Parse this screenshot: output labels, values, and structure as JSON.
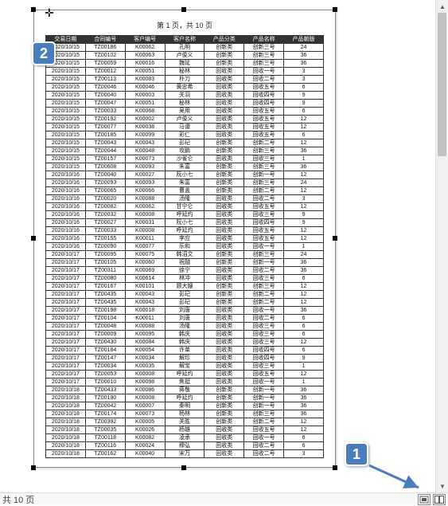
{
  "page_header": "第 1 页，共 10 页",
  "status_text": "共 10 页",
  "callouts": {
    "c1": "1",
    "c2": "2"
  },
  "headers": [
    "交易日期",
    "合同编号",
    "客户编号",
    "客户名称",
    "产品分类",
    "产品名称",
    "产品朝版"
  ],
  "chart_data": {
    "type": "table",
    "columns": [
      "交易日期",
      "合同编号",
      "客户编号",
      "客户名称",
      "产品分类",
      "产品名称",
      "产品朝版"
    ],
    "rows": [
      [
        "2020/10/15",
        "TZ00186",
        "K00062",
        "孔明",
        "创新类",
        "创新三号",
        "24"
      ],
      [
        "2020/10/15",
        "TZ00102",
        "K00063",
        "卢俊义",
        "创新类",
        "创新三号",
        "36"
      ],
      [
        "2020/10/15",
        "TZ00059",
        "K00016",
        "魏延",
        "创新类",
        "创新三号",
        "36"
      ],
      [
        "2020/10/15",
        "TZ00012",
        "K00051",
        "秘林",
        "回收类",
        "回收一号",
        "3"
      ],
      [
        "2020/10/15",
        "TZ00113",
        "K00083",
        "朴刀",
        "回收类",
        "回收二号",
        "3"
      ],
      [
        "2020/10/15",
        "TZ00046",
        "K00046",
        "黄忠希",
        "回收类",
        "回收五号",
        "6"
      ],
      [
        "2020/10/15",
        "TZ00040",
        "K00003",
        "关羽",
        "回收类",
        "回收四号",
        "9"
      ],
      [
        "2020/10/15",
        "TZ00047",
        "K00051",
        "秘林",
        "回收类",
        "回收四号",
        "9"
      ],
      [
        "2020/10/15",
        "TZ00033",
        "K00068",
        "吴用",
        "回收类",
        "回收五号",
        "6"
      ],
      [
        "2020/10/15",
        "TZ00192",
        "K00002",
        "卢俊义",
        "回收类",
        "回收五号",
        "12"
      ],
      [
        "2020/10/15",
        "TZ00077",
        "K00038",
        "马谡",
        "回收类",
        "回收五号",
        "12"
      ],
      [
        "2020/10/15",
        "TZ00185",
        "K00099",
        "彩仁",
        "回收类",
        "回收五号",
        "6"
      ],
      [
        "2020/10/15",
        "TZ00043",
        "K00043",
        "彭玘",
        "创新类",
        "创新二号",
        "12"
      ],
      [
        "2020/10/15",
        "TZ00044",
        "K00048",
        "攻鹏",
        "创新类",
        "创新三号",
        "36"
      ],
      [
        "2020/10/15",
        "TZ00157",
        "K00073",
        "沙雀仑",
        "回收类",
        "回收三号",
        "1"
      ],
      [
        "2020/10/15",
        "TZ00608",
        "K00093",
        "朱富",
        "创新类",
        "创新三号",
        "36"
      ],
      [
        "2020/10/16",
        "TZ00040",
        "K00027",
        "阮小七",
        "创新类",
        "创新一号",
        "12"
      ],
      [
        "2020/10/16",
        "TZ00093",
        "K00093",
        "朱富",
        "创新类",
        "创新三号",
        "24"
      ],
      [
        "2020/10/16",
        "TZ00065",
        "K00066",
        "曹盖",
        "创新类",
        "创新二号",
        "12"
      ],
      [
        "2020/10/16",
        "TZ00020",
        "K00088",
        "汤隆",
        "回收类",
        "回收二号",
        "3"
      ],
      [
        "2020/10/16",
        "TZ00082",
        "K00062",
        "甘宁仑",
        "回收类",
        "回收五号",
        "12"
      ],
      [
        "2020/10/16",
        "TZ00032",
        "K00008",
        "呼延灼",
        "回收类",
        "回收三号",
        "9"
      ],
      [
        "2020/10/16",
        "TZ00027",
        "K00031",
        "阮小七",
        "回收类",
        "回收四号",
        "9"
      ],
      [
        "2020/10/16",
        "TZ00033",
        "K00008",
        "呼延灼",
        "回收类",
        "回收五号",
        "12"
      ],
      [
        "2020/10/16",
        "TZ00155",
        "K00011",
        "李应",
        "回收类",
        "回收五号",
        "12"
      ],
      [
        "2020/10/16",
        "TZ00090",
        "K00077",
        "乐和",
        "回收类",
        "回收一号",
        "1"
      ],
      [
        "2020/10/17",
        "TZ00095",
        "K00075",
        "韩滔文",
        "创新类",
        "创新三号",
        "24"
      ],
      [
        "2020/10/17",
        "TZ00105",
        "K00060",
        "祝融",
        "创新类",
        "创新一号",
        "36"
      ],
      [
        "2020/10/17",
        "TZ00311",
        "K00069",
        "徐宁",
        "回收类",
        "回收二号",
        "36"
      ],
      [
        "2020/10/17",
        "TZ00080",
        "K00614",
        "林冲",
        "回收类",
        "回收三号",
        "6"
      ],
      [
        "2020/10/17",
        "TZ00167",
        "K00101",
        "顾大嫂",
        "创新类",
        "创新三号",
        "12"
      ],
      [
        "2020/10/17",
        "TZ00435",
        "K00043",
        "彭玘",
        "创新类",
        "创新二号",
        "12"
      ],
      [
        "2020/10/17",
        "TZ00435",
        "K00043",
        "彭玘",
        "创新类",
        "创新二号",
        "12"
      ],
      [
        "2020/10/17",
        "TZ00198",
        "K00018",
        "刘唐",
        "回收类",
        "回收一号",
        "36"
      ],
      [
        "2020/10/17",
        "TZ00104",
        "K00011",
        "刘唐",
        "回收类",
        "回收二号",
        "6"
      ],
      [
        "2020/10/17",
        "TZ00048",
        "K00088",
        "汤隆",
        "回收类",
        "回收三号",
        "6"
      ],
      [
        "2020/10/17",
        "TZ00009",
        "K00095",
        "韩庆",
        "回收类",
        "回收三号",
        "6"
      ],
      [
        "2020/10/17",
        "TZ00430",
        "K00084",
        "韩庆",
        "回收类",
        "回收三号",
        "12"
      ],
      [
        "2020/10/17",
        "TZ00184",
        "K00054",
        "许单",
        "回收类",
        "回收四号",
        "6"
      ],
      [
        "2020/10/17",
        "TZ00147",
        "K00034",
        "解珍",
        "回收类",
        "回收四号",
        "9"
      ],
      [
        "2020/10/17",
        "TZ00034",
        "K00035",
        "解宝",
        "回收类",
        "回收三号",
        "1"
      ],
      [
        "2020/10/17",
        "TZ00053",
        "K00008",
        "呼延灼",
        "回收类",
        "回收五号",
        "12"
      ],
      [
        "2020/10/17",
        "TZ00010",
        "K00098",
        "焦挺",
        "回收类",
        "回收一号",
        "1"
      ],
      [
        "2020/10/18",
        "TZ00433",
        "K00086",
        "蒋敬",
        "创新类",
        "创新一号",
        "36"
      ],
      [
        "2020/10/18",
        "TZ00190",
        "K00008",
        "呼延灼",
        "创新类",
        "创新一号",
        "36"
      ],
      [
        "2020/10/18",
        "TZ00042",
        "K00007",
        "秦明",
        "创新类",
        "创新一号",
        "36"
      ],
      [
        "2020/10/18",
        "TZ00174",
        "K00073",
        "杨林",
        "创新类",
        "创新三号",
        "36"
      ],
      [
        "2020/10/18",
        "TZ00392",
        "K00005",
        "关胜",
        "创新类",
        "创新二号",
        "12"
      ],
      [
        "2020/10/18",
        "TZ00035",
        "K00026",
        "杨雄",
        "回收类",
        "回收五号",
        "12"
      ],
      [
        "2020/10/18",
        "TZ00118",
        "K00082",
        "凌承",
        "回收类",
        "回收一号",
        "6"
      ],
      [
        "2020/10/18",
        "TZ00116",
        "K00024",
        "穆弘",
        "回收类",
        "回收二号",
        "6"
      ],
      [
        "2020/10/18",
        "TZ00162",
        "K00040",
        "宋万",
        "回收类",
        "回收二号",
        "3"
      ]
    ]
  }
}
